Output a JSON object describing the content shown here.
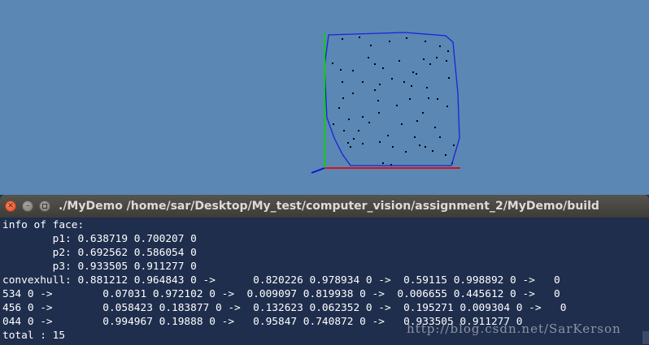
{
  "viewer": {
    "background": "#5b87b5",
    "axis_colors": {
      "x": "#dd1111",
      "y": "#11cc11",
      "z": "#1111cc"
    },
    "hull_color": "#1a24d6",
    "point_color": "#000000"
  },
  "terminal": {
    "title": "./MyDemo  /home/sar/Desktop/My_test/computer_vision/assignment_2/MyDemo/build",
    "lines": [
      "info of face:",
      "        p1: 0.638719 0.700207 0",
      "        p2: 0.692562 0.586054 0",
      "        p3: 0.933505 0.911277 0",
      "convexhull: 0.881212 0.964843 0 ->      0.820226 0.978934 0 ->  0.59115 0.998892 0 ->   0",
      "534 0 ->        0.07031 0.972102 0 ->  0.009097 0.819938 0 ->  0.006655 0.445612 0 ->   0",
      "456 0 ->        0.058423 0.183877 0 ->  0.132623 0.062352 0 ->  0.195271 0.009304 0 ->   0",
      "044 0 ->        0.994967 0.19888 0 ->   0.95847 0.740872 0 ->   0.933505 0.911277 0",
      "total : 15"
    ],
    "background": "#1f2e4d",
    "text_color": "#ffffff"
  },
  "watermark": "http://blog.csdn.net/SarKerson"
}
